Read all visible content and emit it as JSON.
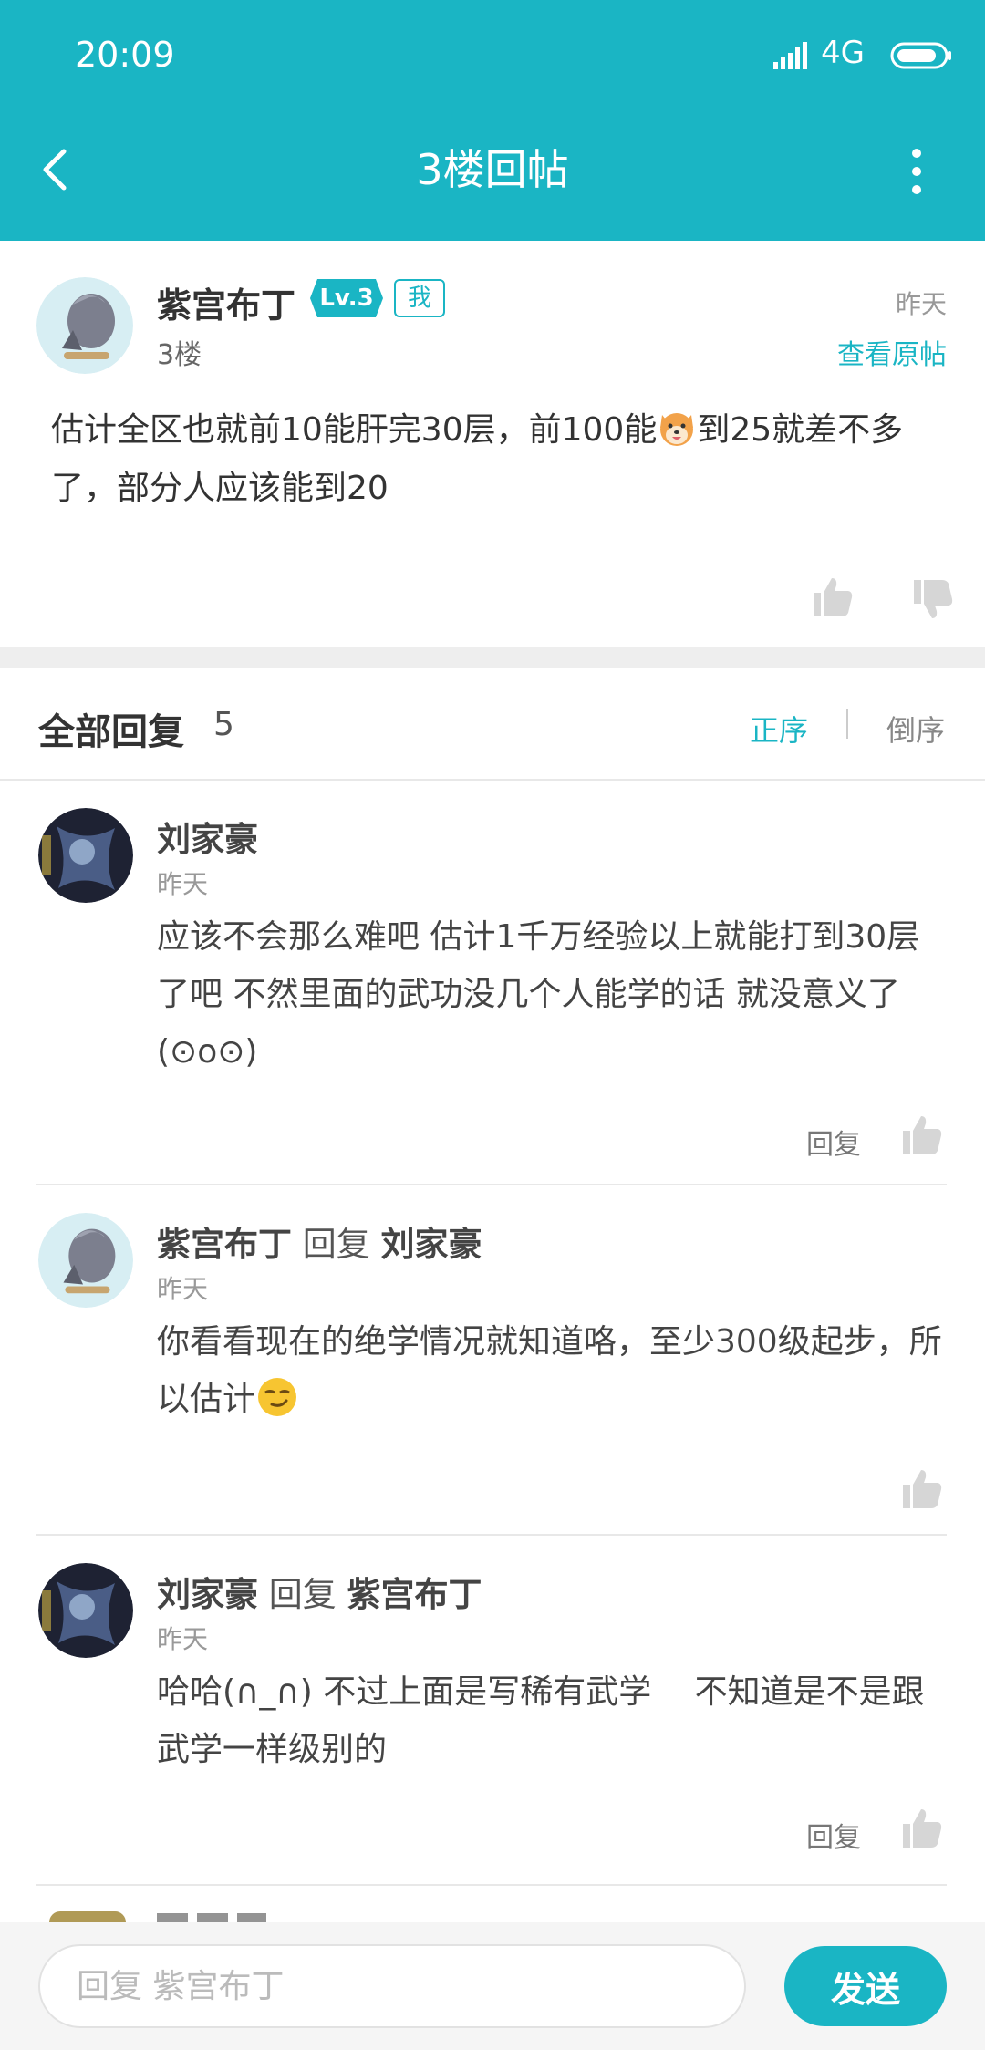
{
  "status_bar": {
    "time": "20:09",
    "network": "4G"
  },
  "header": {
    "title": "3楼回帖"
  },
  "post": {
    "username": "紫宫布丁",
    "level": "Lv.3",
    "me_badge": "我",
    "floor": "3楼",
    "time": "昨天",
    "view_original": "查看原帖",
    "text_before_emoji": "估计全区也就前10能肝完30层，前100能",
    "text_after_emoji": "到25就差不多了，部分人应该能到20"
  },
  "replies_header": {
    "title": "全部回复",
    "count": "5",
    "sort_asc": "正序",
    "sort_desc": "倒序"
  },
  "replies": [
    {
      "author": "刘家豪",
      "reply_word": "",
      "target": "",
      "time": "昨天",
      "text": "应该不会那么难吧 估计1千万经验以上就能打到30层了吧 不然里面的武功没几个人能学的话 就没意义了 (⊙o⊙)",
      "reply_label": "回复"
    },
    {
      "author": "紫宫布丁",
      "reply_word": "回复",
      "target": "刘家豪",
      "time": "昨天",
      "text": "你看看现在的绝学情况就知道咯，至少300级起步，所以估计",
      "reply_label": ""
    },
    {
      "author": "刘家豪",
      "reply_word": "回复",
      "target": "紫宫布丁",
      "time": "昨天",
      "text": "哈哈(∩_∩) 不过上面是写稀有武学　 不知道是不是跟武学一样级别的",
      "reply_label": "回复"
    }
  ],
  "reply_bar": {
    "placeholder": "回复 紫宫布丁",
    "send_label": "发送"
  },
  "colors": {
    "accent": "#1ab5c4",
    "background": "#ffffff",
    "separator": "#eeeeee"
  },
  "icons": [
    "back-icon",
    "more-icon",
    "signal-icon",
    "battery-icon",
    "like-icon",
    "dislike-icon",
    "dog-emoji-icon",
    "smirk-emoji-icon"
  ]
}
